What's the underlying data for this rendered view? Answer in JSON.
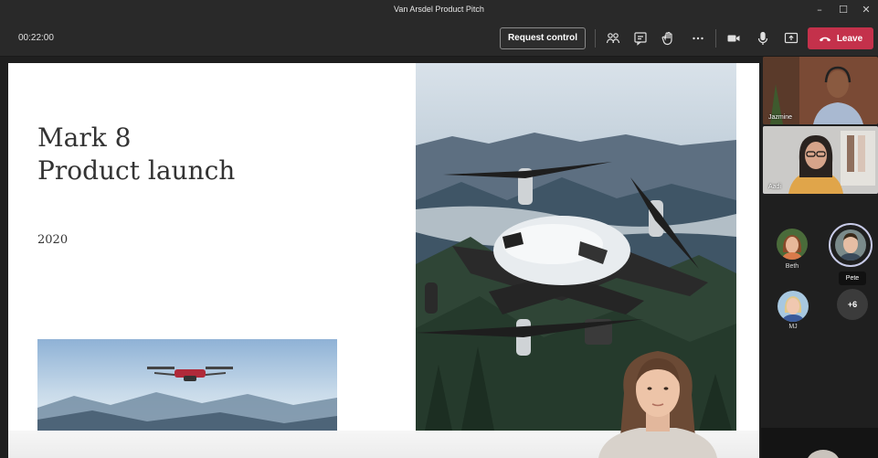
{
  "window": {
    "title": "Van Arsdel Product Pitch"
  },
  "toolbar": {
    "timer": "00:22:00",
    "request_control_label": "Request control",
    "leave_label": "Leave",
    "icons": [
      "people-icon",
      "chat-icon",
      "raise-hand-icon",
      "more-options-icon",
      "camera-icon",
      "microphone-icon",
      "share-screen-icon",
      "phone-hangup-icon"
    ]
  },
  "slide": {
    "title": "Mark 8\nProduct launch",
    "year": "2020"
  },
  "participants": {
    "video": [
      {
        "name": "Jazmine"
      },
      {
        "name": "Aadi"
      }
    ],
    "avatars": [
      {
        "name": "Beth"
      },
      {
        "name": "Pete"
      },
      {
        "name": "MJ"
      }
    ],
    "more_count": "+6"
  },
  "colors": {
    "leave": "#c4314b",
    "active_speaker": "#6264a7",
    "toolbar": "#292929"
  }
}
